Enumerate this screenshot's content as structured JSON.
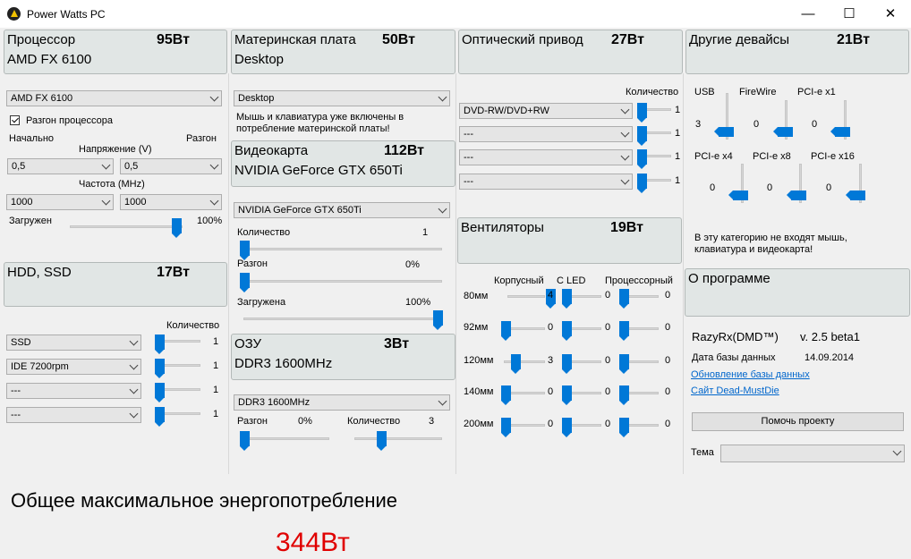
{
  "window": {
    "title": "Power Watts PC",
    "minimize": "—",
    "maximize": "☐",
    "close": "✕"
  },
  "headers": {
    "cpu": {
      "name": "Процессор",
      "watts": "95Вт",
      "sub": "AMD FX 6100"
    },
    "mb": {
      "name": "Материнская плата",
      "watts": "50Вт",
      "sub": "Desktop"
    },
    "optical": {
      "name": "Оптический привод",
      "watts": "27Вт"
    },
    "other": {
      "name": "Другие девайсы",
      "watts": "21Вт"
    },
    "gpu": {
      "name": "Видеокарта",
      "watts": "112Вт",
      "sub": "NVIDIA GeForce GTX 650Ti"
    },
    "hdd": {
      "name": "HDD, SSD",
      "watts": "17Вт"
    },
    "ram": {
      "name": "ОЗУ",
      "watts": "3Вт",
      "sub": "DDR3 1600MHz"
    },
    "fans": {
      "name": "Вентиляторы",
      "watts": "19Вт"
    },
    "about": {
      "name": "О программе"
    }
  },
  "cpu": {
    "model": "AMD FX 6100",
    "overclock_label": "Разгон процессора",
    "overclock_checked": true,
    "initial_label": "Начально",
    "oc_label": "Разгон",
    "voltage_label": "Напряжение (V)",
    "voltage_initial": "0,5",
    "voltage_oc": "0,5",
    "freq_label": "Частота (MHz)",
    "freq_initial": "1000",
    "freq_oc": "1000",
    "load_label": "Загружен",
    "load_value": "100%",
    "load_fraction": 1.0
  },
  "mb": {
    "type": "Desktop",
    "note": "Мышь и клавиатура уже включены в потребление материнской платы!"
  },
  "gpu": {
    "model": "NVIDIA GeForce GTX 650Ti",
    "count_label": "Количество",
    "count_value": "1",
    "oc_label": "Разгон",
    "oc_value": "0%",
    "load_label": "Загружена",
    "load_value": "100%"
  },
  "optical": {
    "count_label": "Количество",
    "drives": [
      {
        "type": "DVD-RW/DVD+RW",
        "count": "1"
      },
      {
        "type": "---",
        "count": "1"
      },
      {
        "type": "---",
        "count": "1"
      },
      {
        "type": "---",
        "count": "1"
      }
    ]
  },
  "other": {
    "devices": [
      {
        "label": "USB",
        "value": "3"
      },
      {
        "label": "FireWire",
        "value": "0"
      },
      {
        "label": "PCI-e x1",
        "value": "0"
      },
      {
        "label": "PCI-e x4",
        "value": "0"
      },
      {
        "label": "PCI-e x8",
        "value": "0"
      },
      {
        "label": "PCI-e x16",
        "value": "0"
      }
    ],
    "note": "В эту категорию не входят мышь, клавиатура и видеокарта!"
  },
  "hdd": {
    "count_label": "Количество",
    "drives": [
      {
        "type": "SSD",
        "count": "1"
      },
      {
        "type": "IDE 7200rpm",
        "count": "1"
      },
      {
        "type": "---",
        "count": "1"
      },
      {
        "type": "---",
        "count": "1"
      }
    ]
  },
  "ram": {
    "type": "DDR3 1600MHz",
    "oc_label": "Разгон",
    "oc_value": "0%",
    "count_label": "Количество",
    "count_value": "3"
  },
  "fans": {
    "col_labels": [
      "Корпусный",
      "C LED",
      "Процессорный"
    ],
    "rows": [
      {
        "size": "80мм",
        "values": [
          "4",
          "0",
          "0"
        ]
      },
      {
        "size": "92мм",
        "values": [
          "0",
          "0",
          "0"
        ]
      },
      {
        "size": "120мм",
        "values": [
          "3",
          "0",
          "0"
        ]
      },
      {
        "size": "140мм",
        "values": [
          "0",
          "0",
          "0"
        ]
      },
      {
        "size": "200мм",
        "values": [
          "0",
          "0",
          "0"
        ]
      }
    ]
  },
  "about": {
    "product": "RazyRx(DMD™)",
    "version": "v. 2.5 beta1",
    "db_date_label": "Дата базы данных",
    "db_date": "14.09.2014",
    "update_link": "Обновление базы данных",
    "site_link": "Сайт Dead-MustDie",
    "help_button": "Помочь проекту",
    "theme_label": "Тема",
    "theme_value": ""
  },
  "total": {
    "label": "Общее максимальное энергопотребление",
    "value": "344Вт"
  }
}
